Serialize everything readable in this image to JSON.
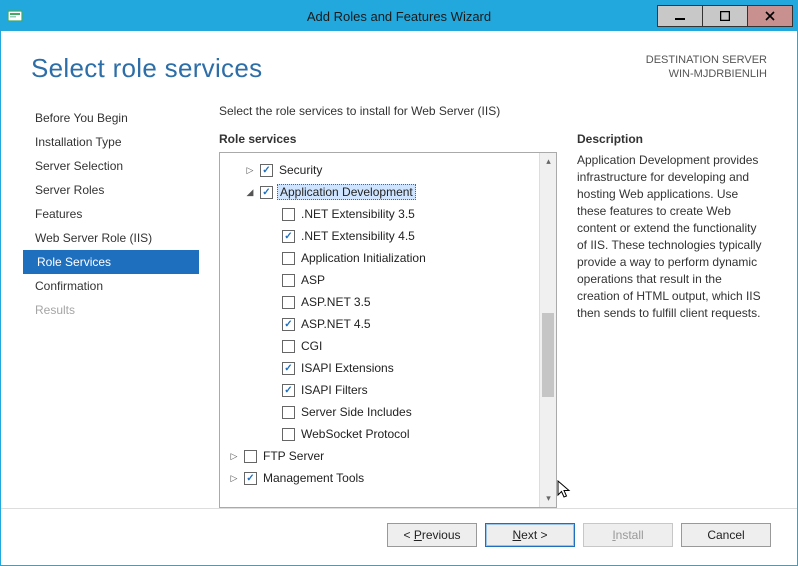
{
  "titlebar": {
    "title": "Add Roles and Features Wizard"
  },
  "header": {
    "page_title": "Select role services",
    "dest_label": "DESTINATION SERVER",
    "dest_value": "WIN-MJDRBIENLIH"
  },
  "sidebar": {
    "items": [
      {
        "label": "Before You Begin"
      },
      {
        "label": "Installation Type"
      },
      {
        "label": "Server Selection"
      },
      {
        "label": "Server Roles"
      },
      {
        "label": "Features"
      },
      {
        "label": "Web Server Role (IIS)"
      },
      {
        "label": "Role Services"
      },
      {
        "label": "Confirmation"
      },
      {
        "label": "Results"
      }
    ]
  },
  "main": {
    "intro": "Select the role services to install for Web Server (IIS)",
    "tree_label": "Role services",
    "desc_label": "Description",
    "desc_text": "Application Development provides infrastructure for developing and hosting Web applications. Use these features to create Web content or extend the functionality of IIS. These technologies typically provide a way to perform dynamic operations that result in the creation of HTML output, which IIS then sends to fulfill client requests."
  },
  "tree": {
    "rows": [
      {
        "label": "Security",
        "checked": true,
        "toggle": "▷"
      },
      {
        "label": "Application Development",
        "checked": true,
        "toggle": "◢",
        "selected": true
      },
      {
        "label": ".NET Extensibility 3.5",
        "checked": false
      },
      {
        "label": ".NET Extensibility 4.5",
        "checked": true
      },
      {
        "label": "Application Initialization",
        "checked": false
      },
      {
        "label": "ASP",
        "checked": false
      },
      {
        "label": "ASP.NET 3.5",
        "checked": false
      },
      {
        "label": "ASP.NET 4.5",
        "checked": true
      },
      {
        "label": "CGI",
        "checked": false
      },
      {
        "label": "ISAPI Extensions",
        "checked": true
      },
      {
        "label": "ISAPI Filters",
        "checked": true
      },
      {
        "label": "Server Side Includes",
        "checked": false
      },
      {
        "label": "WebSocket Protocol",
        "checked": false
      },
      {
        "label": "FTP Server",
        "checked": false,
        "toggle": "▷"
      },
      {
        "label": "Management Tools",
        "checked": true,
        "toggle": "▷"
      }
    ]
  },
  "buttons": {
    "previous": "Previous",
    "next": "ext >",
    "install": "nstall",
    "cancel": "Cancel"
  }
}
